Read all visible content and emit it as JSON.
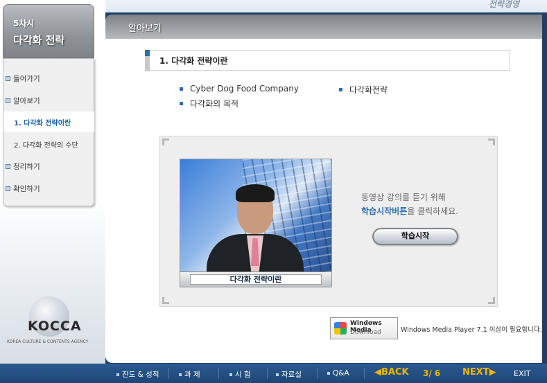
{
  "app": {
    "brand_text": "전략경영"
  },
  "lesson": {
    "number": "5차시",
    "title": "다각화 전략"
  },
  "menu": {
    "items": [
      {
        "label": "들어가기",
        "type": "main"
      },
      {
        "label": "알아보기",
        "type": "main"
      },
      {
        "label": "1. 다각화 전략이란",
        "type": "sub",
        "active": true
      },
      {
        "label": "2. 다각화 전략의 수단",
        "type": "sub"
      },
      {
        "label": "정리하기",
        "type": "main"
      },
      {
        "label": "확인하기",
        "type": "main"
      }
    ]
  },
  "logo": {
    "name": "KOCCA",
    "subtitle": "KOREA CULTURE & CONTENTS AGENCY"
  },
  "main": {
    "header_title": "알아보기",
    "section_title": "1. 다각화 전략이란",
    "topics": [
      "Cyber Dog Food Company",
      "다각화전략",
      "다각화의 목적"
    ]
  },
  "video": {
    "caption": "다각화 전략이란",
    "instruction_line1": "동영상 강의를 듣기 위해",
    "instruction_highlight": "학습시작버튼",
    "instruction_line2_suffix": "을 클릭하세요.",
    "start_button": "학습시작"
  },
  "wmp": {
    "badge_line1": "Windows Media",
    "badge_line2": "Download",
    "note": "Windows Media Player 7.1 이상이 필요합니다."
  },
  "nav": {
    "progress": "진도 & 성적",
    "assignment": "과 제",
    "exam": "시 험",
    "library": "자료실",
    "qa": "Q&A",
    "back": "◀BACK",
    "page": "3/ 6",
    "next": "NEXT▶",
    "exit": "EXIT"
  },
  "colors": {
    "accent": "#2e6db5",
    "nav_bg": "#1d4677",
    "nav_highlight": "#f4b400"
  }
}
